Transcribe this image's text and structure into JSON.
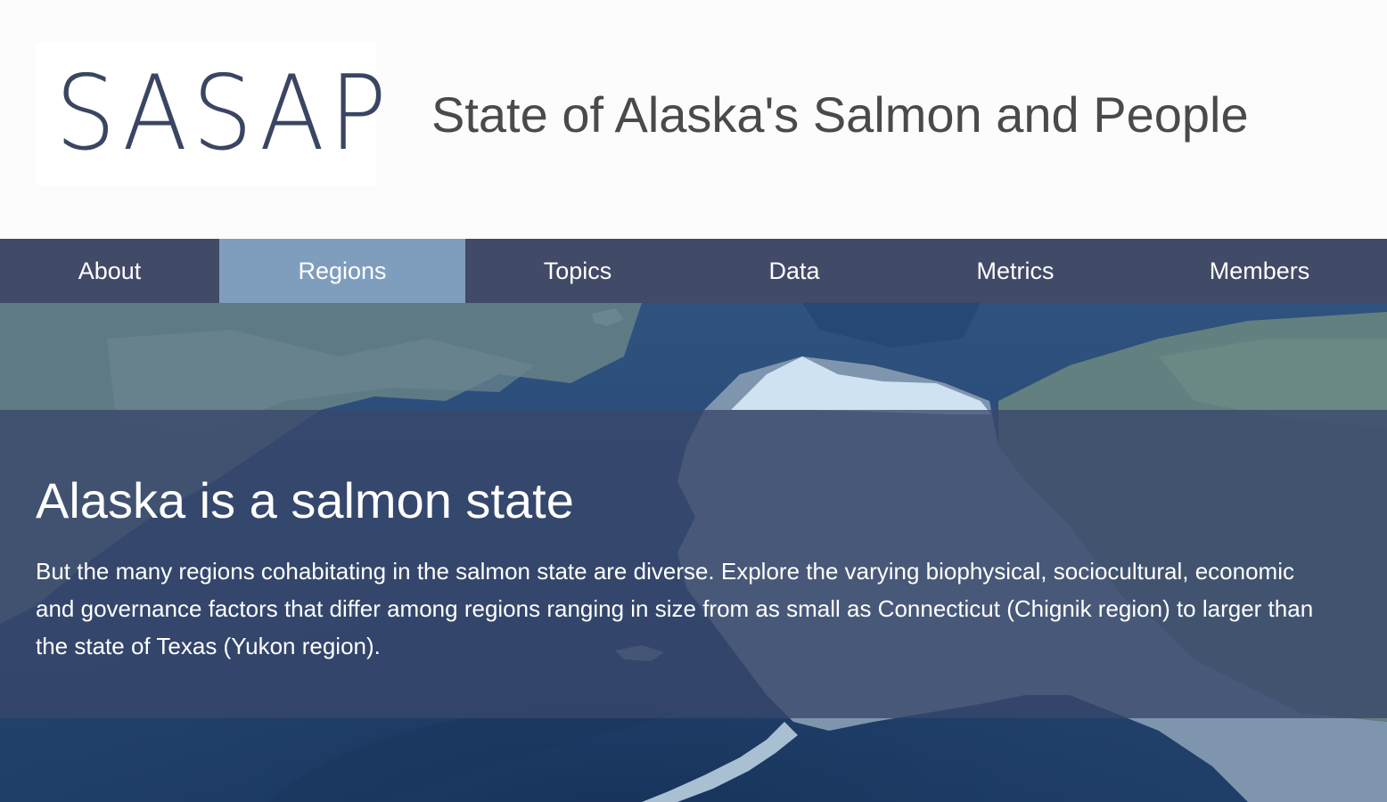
{
  "header": {
    "logo_text": "SASAP",
    "site_title": "State of Alaska's Salmon and People"
  },
  "nav": {
    "items": [
      {
        "label": "About",
        "active": false
      },
      {
        "label": "Regions",
        "active": true
      },
      {
        "label": "Topics",
        "active": false
      },
      {
        "label": "Data",
        "active": false
      },
      {
        "label": "Metrics",
        "active": false
      },
      {
        "label": "Members",
        "active": false
      }
    ]
  },
  "hero": {
    "heading": "Alaska is a salmon state",
    "body": "But the many regions cohabitating in the salmon state are diverse. Explore the varying biophysical, sociocultural, economic and governance factors that differ among regions ranging in size from as small as Connecticut (Chignik region) to larger than the state of Texas (Yukon region)."
  },
  "colors": {
    "nav_background": "#414a66",
    "nav_active": "#7f9ebd",
    "logo": "#3a4563",
    "overlay": "#38466a"
  }
}
